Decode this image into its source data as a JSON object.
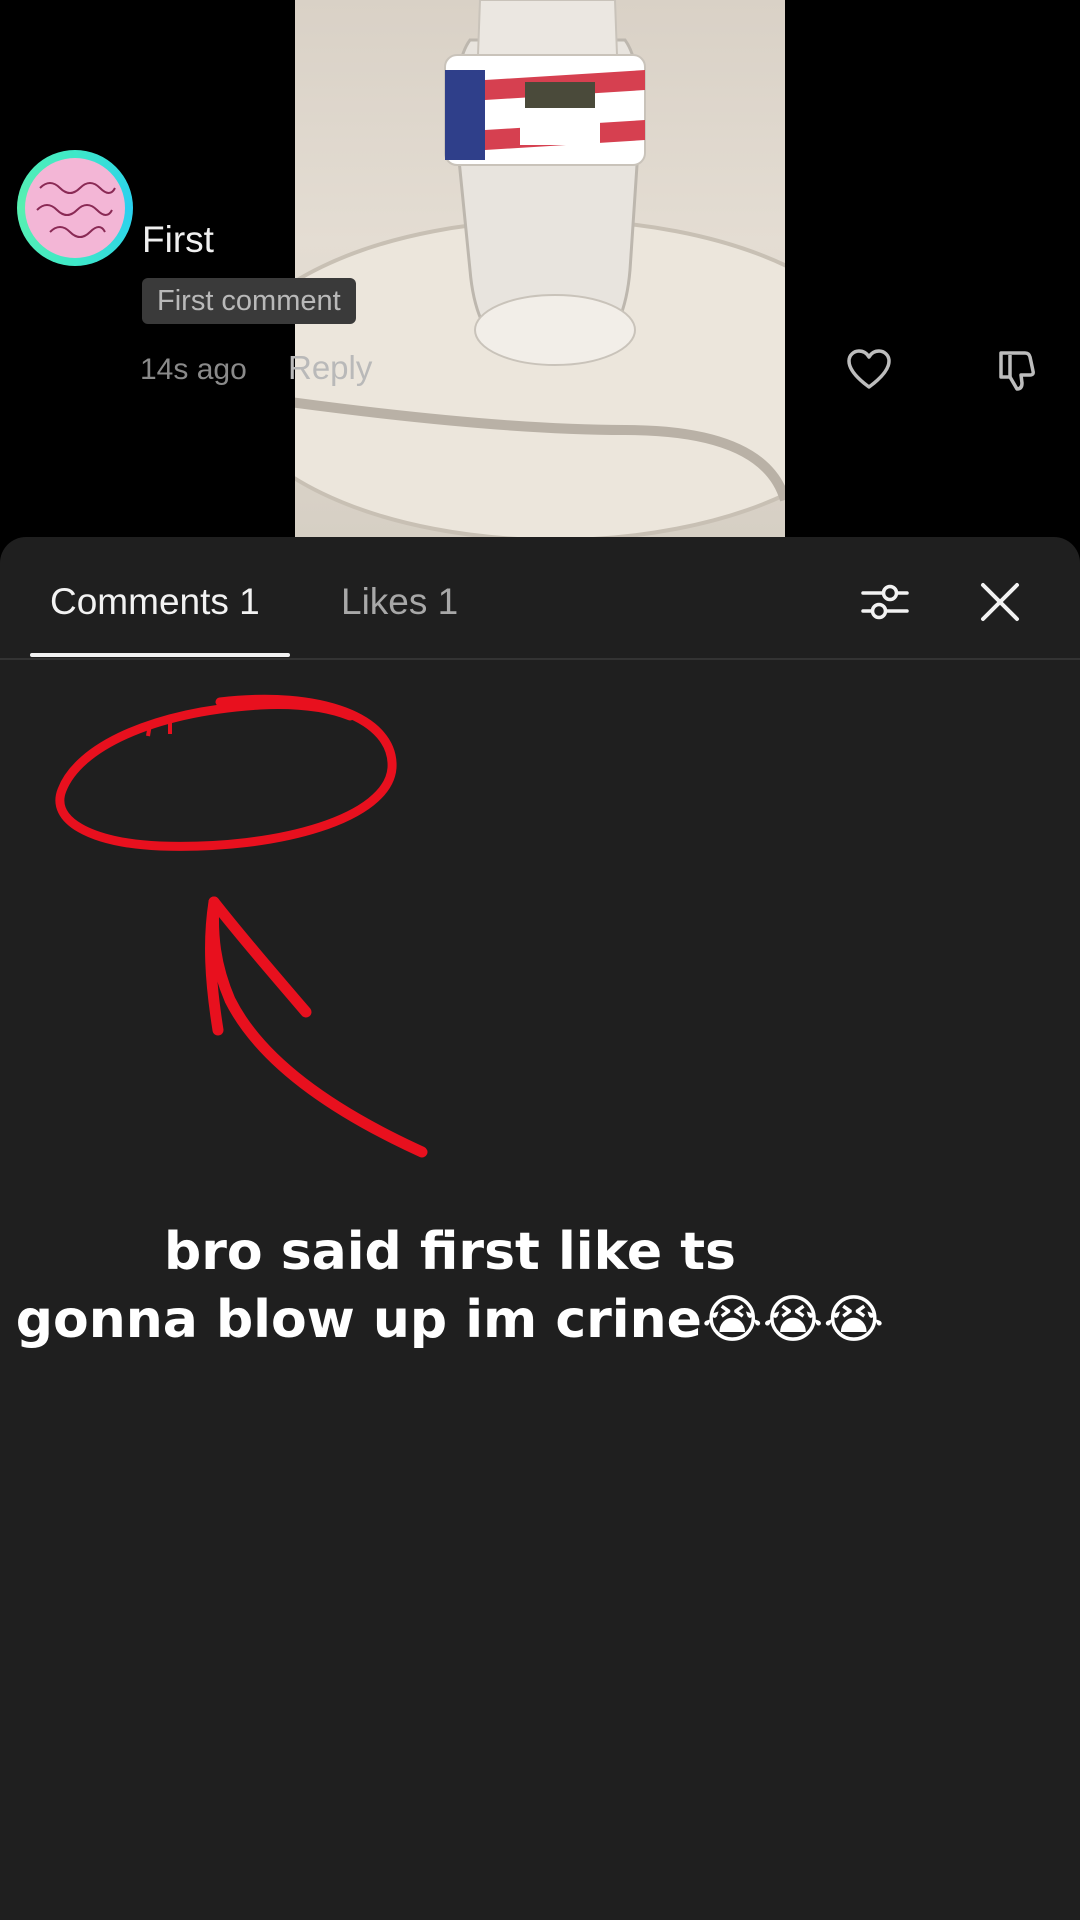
{
  "tabs": {
    "comments_label": "Comments 1",
    "likes_label": "Likes 1"
  },
  "icons": {
    "filter": "sliders-icon",
    "close": "close-icon",
    "like": "heart-icon",
    "dislike": "thumbs-down-icon"
  },
  "comment": {
    "text": "First",
    "badge": "First comment",
    "time": "14s ago",
    "reply_label": "Reply"
  },
  "caption": {
    "line1": "bro said first like ts",
    "line2": "gonna blow up im crine😭😭😭"
  },
  "colors": {
    "sheet_background": "#1f1f1f",
    "annotation_red": "#e8101e",
    "avatar_ring": "#3ee8c8"
  }
}
